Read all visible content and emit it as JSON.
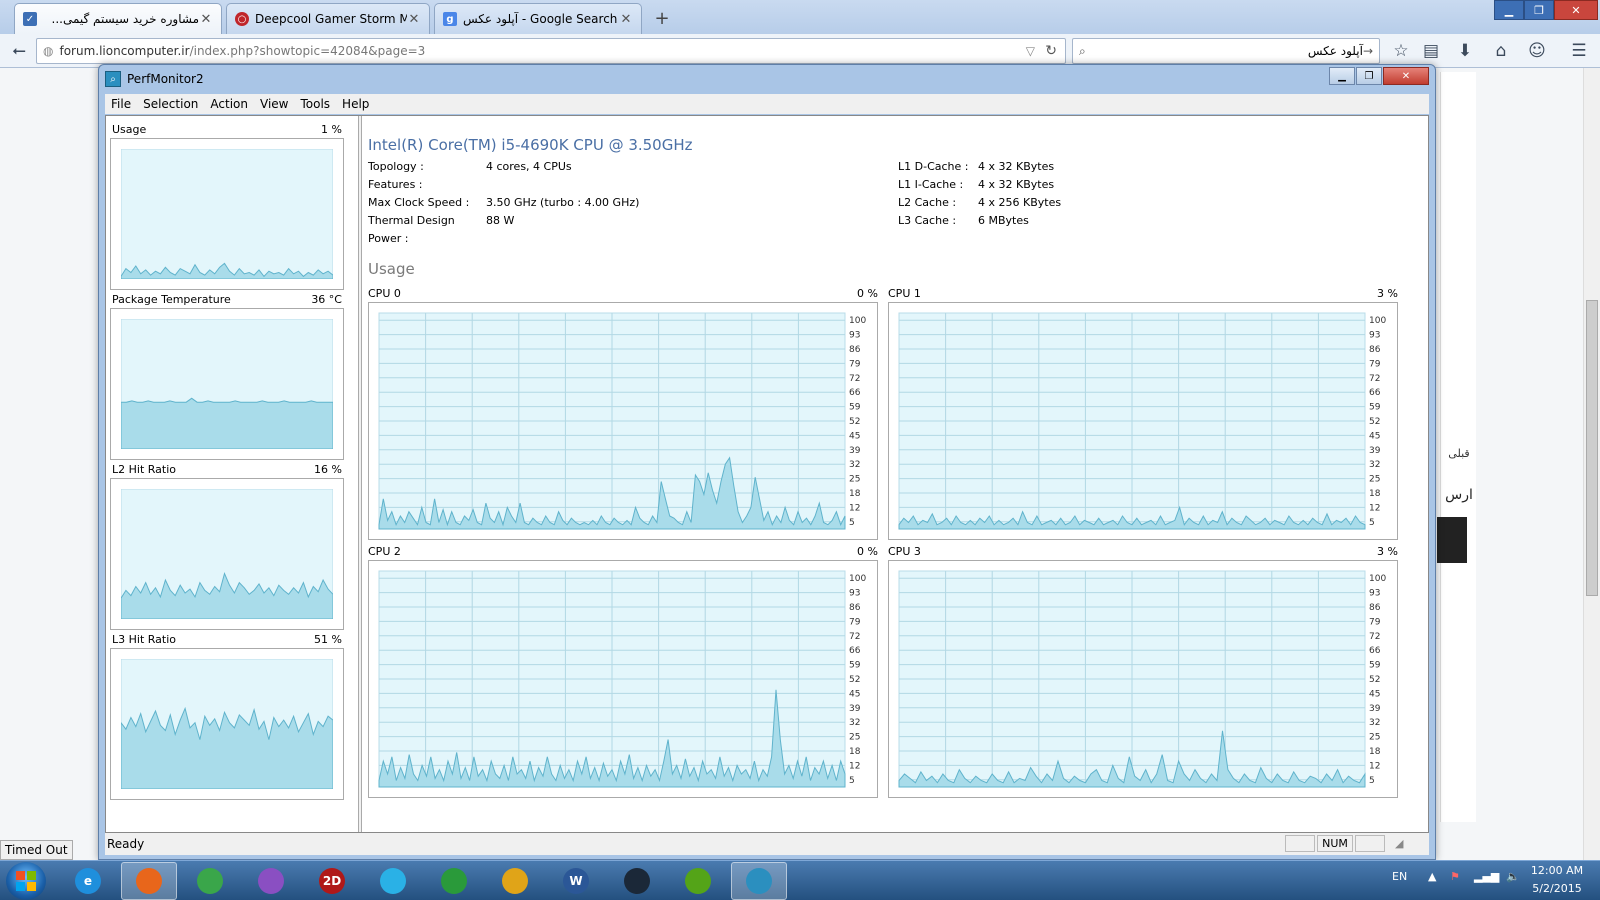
{
  "browser": {
    "tabs": [
      {
        "label": "مشاوره خرید سیستم گیمی...",
        "active": true,
        "icon_color": "#3d6fb5"
      },
      {
        "label": "Deepcool Gamer Storm Ma...",
        "active": false,
        "icon_color": "#c0262b"
      },
      {
        "label": "آپلود عکس - Google Search",
        "active": false,
        "icon_color": "#4a86e8"
      }
    ],
    "new_tab_glyph": "+",
    "url_domain": "forum.lioncomputer.ir",
    "url_path": "/index.php?showtopic=42084&page=3",
    "search_value": "آپلود عکس"
  },
  "background_page": {
    "side_text_1": "قبلی",
    "side_text_2": "ارس",
    "timed_out": "Timed Out"
  },
  "window": {
    "title": "PerfMonitor2",
    "menu": [
      "File",
      "Selection",
      "Action",
      "View",
      "Tools",
      "Help"
    ],
    "status_text": "Ready",
    "status_num": "NUM"
  },
  "left_panels": [
    {
      "label": "Usage",
      "value": "1 %"
    },
    {
      "label": "Package Temperature",
      "value": "36 °C"
    },
    {
      "label": "L2 Hit Ratio",
      "value": "16 %"
    },
    {
      "label": "L3 Hit Ratio",
      "value": "51 %"
    }
  ],
  "cpu": {
    "name": "Intel(R) Core(TM) i5-4690K CPU @ 3.50GHz",
    "left_info": [
      {
        "key": "Topology :",
        "value": "4 cores, 4 CPUs"
      },
      {
        "key": "Features :",
        "value": ""
      },
      {
        "key": "Max Clock Speed :",
        "value": "3.50 GHz (turbo : 4.00 GHz)"
      },
      {
        "key": "Thermal Design Power :",
        "value": "88 W"
      }
    ],
    "right_info": [
      {
        "key": "L1 D-Cache :",
        "value": "4 x 32 KBytes"
      },
      {
        "key": "L1 I-Cache :",
        "value": "4 x 32 KBytes"
      },
      {
        "key": "L2 Cache :",
        "value": "4 x 256 KBytes"
      },
      {
        "key": "L3 Cache :",
        "value": "6 MBytes"
      }
    ]
  },
  "usage_section": {
    "title": "Usage",
    "cores": [
      {
        "label": "CPU 0",
        "value": "0 %"
      },
      {
        "label": "CPU 1",
        "value": "3 %"
      },
      {
        "label": "CPU 2",
        "value": "0 %"
      },
      {
        "label": "CPU 3",
        "value": "3 %"
      }
    ],
    "y_ticks": [
      "100",
      "93",
      "86",
      "79",
      "72",
      "66",
      "59",
      "52",
      "45",
      "39",
      "32",
      "25",
      "18",
      "12",
      "5"
    ]
  },
  "chart_data": [
    {
      "type": "area",
      "title": "CPU 0",
      "ylim": [
        0,
        100
      ],
      "values": [
        2,
        14,
        4,
        8,
        2,
        6,
        3,
        8,
        5,
        2,
        10,
        3,
        2,
        14,
        3,
        9,
        2,
        8,
        3,
        2,
        6,
        4,
        9,
        3,
        2,
        12,
        5,
        3,
        8,
        2,
        10,
        6,
        3,
        12,
        3,
        2,
        5,
        3,
        2,
        6,
        3,
        2,
        8,
        4,
        2,
        5,
        3,
        2,
        3,
        2,
        4,
        2,
        6,
        3,
        2,
        5,
        3,
        2,
        4,
        2,
        10,
        5,
        3,
        2,
        6,
        3,
        22,
        14,
        6,
        5,
        3,
        2,
        8,
        3,
        25,
        22,
        16,
        26,
        18,
        12,
        22,
        30,
        33,
        20,
        8,
        3,
        6,
        10,
        24,
        14,
        4,
        8,
        2,
        6,
        3,
        10,
        4,
        2,
        8,
        3,
        5,
        2,
        6,
        12,
        3,
        2,
        4,
        8,
        2,
        6
      ]
    },
    {
      "type": "area",
      "title": "CPU 1",
      "ylim": [
        0,
        100
      ],
      "values": [
        2,
        5,
        3,
        6,
        2,
        4,
        3,
        7,
        2,
        3,
        5,
        2,
        6,
        3,
        2,
        4,
        2,
        5,
        3,
        6,
        2,
        4,
        2,
        3,
        5,
        2,
        8,
        3,
        2,
        6,
        2,
        3,
        4,
        2,
        5,
        2,
        3,
        6,
        2,
        4,
        3,
        2,
        5,
        2,
        3,
        4,
        2,
        6,
        3,
        2,
        5,
        2,
        3,
        4,
        2,
        6,
        2,
        3,
        4,
        10,
        2,
        5,
        3,
        2,
        6,
        2,
        4,
        3,
        8,
        2,
        5,
        3,
        2,
        6,
        4,
        2,
        3,
        5,
        2,
        4,
        3,
        2,
        6,
        3,
        2,
        4,
        2,
        5,
        3,
        2,
        7,
        2,
        4,
        3,
        5,
        2,
        6,
        3,
        2
      ]
    },
    {
      "type": "area",
      "title": "CPU 2",
      "ylim": [
        0,
        100
      ],
      "values": [
        3,
        12,
        6,
        14,
        3,
        9,
        4,
        15,
        6,
        3,
        10,
        5,
        14,
        4,
        8,
        3,
        12,
        6,
        16,
        4,
        9,
        3,
        14,
        5,
        8,
        3,
        12,
        6,
        4,
        10,
        3,
        14,
        6,
        8,
        4,
        12,
        3,
        9,
        5,
        14,
        6,
        3,
        10,
        4,
        8,
        3,
        12,
        6,
        14,
        4,
        9,
        3,
        11,
        5,
        8,
        3,
        12,
        6,
        15,
        4,
        9,
        3,
        10,
        5,
        8,
        3,
        12,
        22,
        6,
        10,
        4,
        13,
        5,
        9,
        3,
        12,
        6,
        8,
        4,
        14,
        5,
        9,
        3,
        10,
        6,
        8,
        4,
        12,
        3,
        8,
        5,
        14,
        45,
        22,
        6,
        10,
        4,
        12,
        5,
        14,
        3,
        9,
        6,
        12,
        4,
        10,
        3,
        12,
        6
      ]
    },
    {
      "type": "area",
      "title": "CPU 3",
      "ylim": [
        0,
        100
      ],
      "values": [
        3,
        6,
        4,
        2,
        7,
        3,
        5,
        2,
        6,
        3,
        2,
        8,
        4,
        2,
        5,
        3,
        2,
        6,
        3,
        2,
        7,
        2,
        4,
        3,
        9,
        5,
        2,
        6,
        3,
        12,
        4,
        2,
        5,
        3,
        2,
        6,
        8,
        3,
        2,
        10,
        4,
        2,
        14,
        5,
        3,
        8,
        2,
        6,
        15,
        3,
        2,
        12,
        6,
        3,
        8,
        4,
        2,
        6,
        3,
        26,
        8,
        4,
        2,
        6,
        3,
        2,
        9,
        4,
        2,
        6,
        3,
        2,
        7,
        3,
        2,
        5,
        4,
        2,
        6,
        3,
        8,
        2,
        5,
        3,
        2,
        6
      ]
    },
    {
      "type": "area",
      "title": "Usage",
      "ylim": [
        0,
        100
      ],
      "values": [
        2,
        8,
        5,
        10,
        4,
        7,
        3,
        6,
        4,
        9,
        5,
        3,
        8,
        6,
        4,
        11,
        5,
        3,
        7,
        4,
        9,
        12,
        6,
        3,
        8,
        4,
        5,
        3,
        7,
        2,
        6,
        4,
        5,
        3,
        8,
        4,
        6,
        2,
        5,
        3,
        7,
        4,
        6,
        3
      ]
    },
    {
      "type": "area",
      "title": "Package Temperature",
      "ylim": [
        0,
        100
      ],
      "values": [
        36,
        36,
        37,
        36,
        36,
        37,
        36,
        36,
        36,
        37,
        36,
        36,
        36,
        39,
        36,
        36,
        37,
        36,
        36,
        36,
        36,
        37,
        36,
        36,
        36,
        36,
        37,
        36,
        36,
        36,
        37,
        36,
        36,
        36,
        36,
        37,
        36,
        36,
        36,
        36
      ]
    },
    {
      "type": "area",
      "title": "L2 Hit Ratio",
      "ylim": [
        0,
        100
      ],
      "values": [
        16,
        22,
        18,
        25,
        20,
        28,
        19,
        24,
        17,
        30,
        22,
        18,
        26,
        20,
        23,
        17,
        28,
        22,
        19,
        25,
        21,
        35,
        26,
        20,
        28,
        24,
        19,
        22,
        27,
        20,
        24,
        18,
        26,
        22,
        19,
        24,
        20,
        28,
        17,
        25,
        21,
        30,
        23,
        19
      ]
    },
    {
      "type": "area",
      "title": "L3 Hit Ratio",
      "ylim": [
        0,
        100
      ],
      "values": [
        51,
        46,
        55,
        48,
        58,
        44,
        52,
        60,
        49,
        45,
        57,
        42,
        53,
        62,
        47,
        51,
        38,
        56,
        49,
        54,
        45,
        59,
        51,
        47,
        57,
        53,
        49,
        61,
        46,
        52,
        38,
        55,
        48,
        53,
        47,
        56,
        44,
        51,
        58,
        42,
        52,
        48,
        56,
        53
      ]
    }
  ],
  "taskbar": {
    "apps": [
      {
        "name": "internet-explorer",
        "glyph": "e",
        "color": "#1f8fdc"
      },
      {
        "name": "firefox",
        "glyph": "",
        "color": "#e8661b"
      },
      {
        "name": "chrome",
        "glyph": "",
        "color": "#3aa64a"
      },
      {
        "name": "messenger",
        "glyph": "",
        "color": "#8a4fc2"
      },
      {
        "name": "app-2d",
        "glyph": "2D",
        "color": "#b01818"
      },
      {
        "name": "sync",
        "glyph": "",
        "color": "#2ab1e6"
      },
      {
        "name": "download-manager",
        "glyph": "",
        "color": "#2a9a3a"
      },
      {
        "name": "winamp",
        "glyph": "",
        "color": "#e0a418"
      },
      {
        "name": "word",
        "glyph": "W",
        "color": "#2b5797"
      },
      {
        "name": "steam",
        "glyph": "",
        "color": "#1b2838"
      },
      {
        "name": "utorrent",
        "glyph": "",
        "color": "#54a418"
      },
      {
        "name": "perfmonitor",
        "glyph": "",
        "color": "#2b8fbf"
      }
    ],
    "lang": "EN",
    "time": "12:00 AM",
    "date": "5/2/2015"
  }
}
